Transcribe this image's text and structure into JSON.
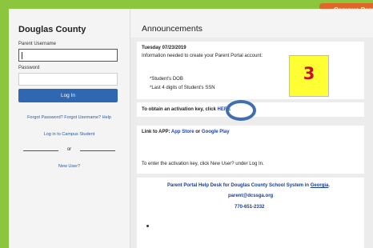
{
  "top_tab": {
    "label": "Campus Paren"
  },
  "login": {
    "county": "Douglas County",
    "username_label": "Parent Username",
    "username_value": "",
    "password_label": "Password",
    "password_value": "",
    "login_button": "Log In",
    "forgot_password": "Forgot Password?",
    "forgot_username": "Forgot Username?",
    "help": "Help",
    "campus_student": "Log in to Campus Student",
    "or": "or",
    "new_user": "New User?"
  },
  "announcements": {
    "title": "Announcements",
    "date": "Tuesday 07/23/2019",
    "intro": "Information needed to create your Parent Portal account:",
    "req1": "*Student's DOB",
    "req2": "*Last 4 digits of Student's SSN",
    "badge": "3",
    "activation_text": "To obtain an activation key, click",
    "activation_link": "HERE",
    "app_text": "Link to APP:",
    "app_store": "App Store",
    "or_word": "or",
    "google_play": "Google Play",
    "enter_key": "To enter the activation key, click New User? under Log In.",
    "help_desk_text": "Parent Portal Help Desk for Douglas County School System in",
    "help_desk_state": "Georgia",
    "help_desk_period": ".",
    "email": "parent@dcssga.org",
    "phone": "770-651-2332"
  },
  "colors": {
    "accent_green": "#8cc63f",
    "tab_orange": "#e2662a",
    "button_blue": "#2f67b0",
    "badge_yellow": "#ffff33",
    "badge_red": "#c8102e"
  }
}
